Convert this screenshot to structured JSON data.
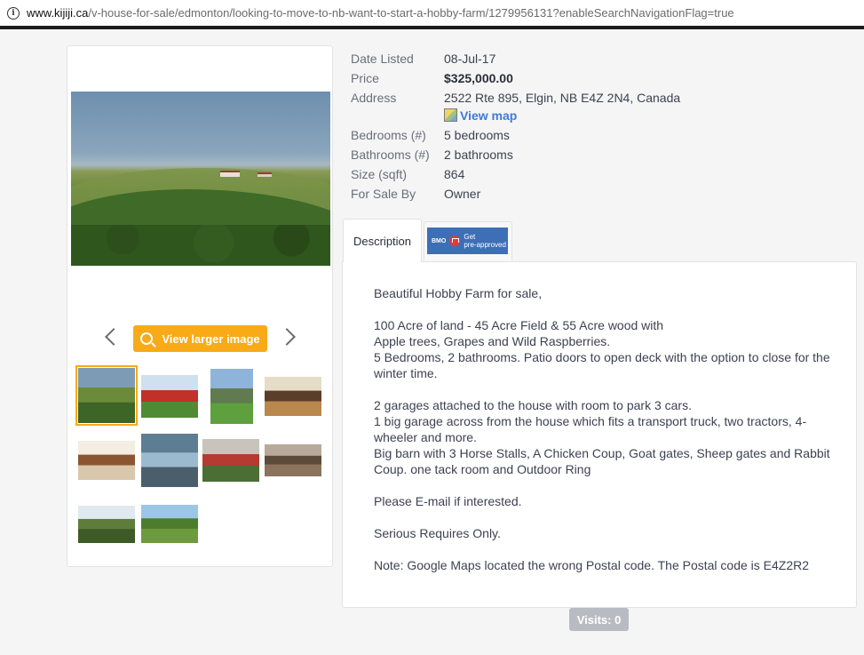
{
  "browser": {
    "url_host": "www.kijiji.ca",
    "url_path": "/v-house-for-sale/edmonton/looking-to-move-to-nb-want-to-start-a-hobby-farm/1279956131?enableSearchNavigationFlag=true"
  },
  "gallery": {
    "view_larger_label": "View larger image",
    "thumbnails": [
      {
        "name": "thumb-farm-landscape",
        "colors": [
          "#7d9bb5",
          "#6b8a3a",
          "#3d6526"
        ]
      },
      {
        "name": "thumb-house-red-barn",
        "colors": [
          "#cfe0ef",
          "#c2302a",
          "#4f8b34"
        ]
      },
      {
        "name": "thumb-house-hill",
        "colors": [
          "#8fb4d9",
          "#5f7b4f",
          "#5da03d"
        ]
      },
      {
        "name": "thumb-living-room",
        "colors": [
          "#e6dcc7",
          "#5a3e29",
          "#b8884c"
        ]
      },
      {
        "name": "thumb-kitchen",
        "colors": [
          "#f3ede2",
          "#8a5530",
          "#d8c7ad"
        ]
      },
      {
        "name": "thumb-hallway",
        "colors": [
          "#5d7d93",
          "#9bbad0",
          "#4a5f6b"
        ]
      },
      {
        "name": "thumb-barn",
        "colors": [
          "#c8c3bb",
          "#b43a32",
          "#4b6e35"
        ]
      },
      {
        "name": "thumb-horses",
        "colors": [
          "#b8a99b",
          "#5d4a3b",
          "#8b735d"
        ]
      },
      {
        "name": "thumb-fence-field",
        "colors": [
          "#dfe9ef",
          "#5e7d3a",
          "#3e5a26"
        ]
      },
      {
        "name": "thumb-orchard",
        "colors": [
          "#9cc6e6",
          "#4d7d2c",
          "#6d9a3f"
        ]
      }
    ]
  },
  "details": {
    "date_listed_label": "Date Listed",
    "date_listed_value": "08-Jul-17",
    "price_label": "Price",
    "price_value": "$325,000.00",
    "address_label": "Address",
    "address_value": "2522 Rte 895, Elgin, NB E4Z 2N4, Canada",
    "view_map_label": "View map",
    "bedrooms_label": "Bedrooms (#)",
    "bedrooms_value": "5 bedrooms",
    "bathrooms_label": "Bathrooms (#)",
    "bathrooms_value": "2 bathrooms",
    "size_label": "Size (sqft)",
    "size_value": "864",
    "for_sale_by_label": "For Sale By",
    "for_sale_by_value": "Owner"
  },
  "tabs": {
    "description_label": "Description",
    "bmo_brand": "BMO",
    "bmo_line1": "Get",
    "bmo_line2": "pre-approved"
  },
  "description": {
    "p1": "Beautiful Hobby Farm for sale,",
    "p2_l1": "100 Acre of land - 45 Acre Field & 55 Acre wood with",
    "p2_l2": "Apple trees, Grapes and Wild Raspberries.",
    "p2_l3": "5 Bedrooms, 2 bathrooms. Patio doors to open deck with the option to close for the winter time.",
    "p3_l1": "2 garages attached to the house with room to park 3 cars.",
    "p3_l2": "1 big garage across from the house which fits a transport truck, two tractors, 4-wheeler and more.",
    "p3_l3": "Big barn with 3 Horse Stalls, A Chicken Coup, Goat gates, Sheep gates and Rabbit Coup. one tack room and Outdoor Ring",
    "p4": "Please E-mail if interested.",
    "p5": "Serious Requires Only.",
    "p6": "Note: Google Maps located the wrong Postal code. The Postal code is E4Z2R2"
  },
  "visits_label": "Visits: 0"
}
